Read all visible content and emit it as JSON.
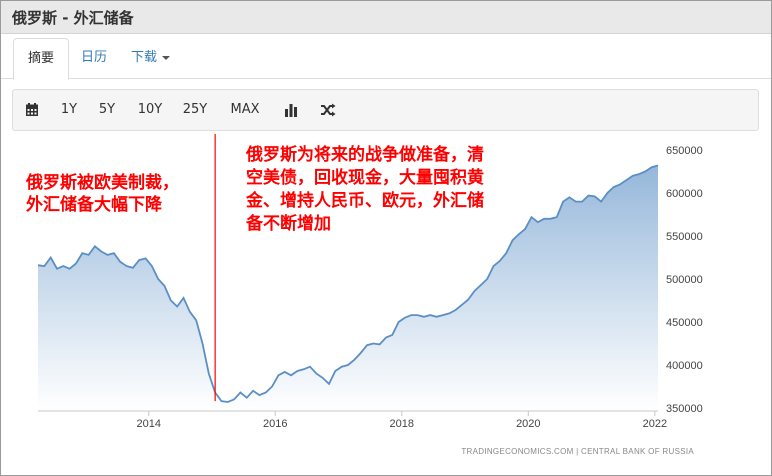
{
  "window": {
    "title": "俄罗斯 - 外汇储备"
  },
  "tabs": [
    {
      "label": "摘要",
      "active": true
    },
    {
      "label": "日历",
      "active": false
    },
    {
      "label": "下载",
      "active": false,
      "dropdown": true
    }
  ],
  "toolbar": {
    "icons": [
      "calendar-icon",
      "bar-chart-icon",
      "shuffle-icon"
    ],
    "ranges": [
      "1Y",
      "5Y",
      "10Y",
      "25Y",
      "MAX"
    ]
  },
  "annotations": {
    "left": [
      "俄罗斯被欧美制裁，",
      "外汇储备大幅下降"
    ],
    "right": [
      "俄罗斯为将来的战争做准备，清",
      "空美债，回收现金，大量囤积黄",
      "金、增持人民币、欧元，外汇储",
      "备不断增加"
    ],
    "marker_color": "#ff0000"
  },
  "source": "TRADINGECONOMICS.COM  |  CENTRAL BANK OF RUSSIA",
  "colors": {
    "line": "#5b8fc4",
    "fill_top": "#8fb3d8",
    "fill_bottom": "#ffffff"
  },
  "chart_data": {
    "type": "area",
    "xlim": [
      2012.25,
      2022.05
    ],
    "ylim": [
      350000,
      650000
    ],
    "x_ticks": [
      2014,
      2016,
      2018,
      2020,
      2022
    ],
    "x_tick_labels": [
      "2014",
      "2016",
      "2018",
      "2020",
      "2022"
    ],
    "y_ticks": [
      350000,
      400000,
      450000,
      500000,
      550000,
      600000,
      650000
    ],
    "y_tick_labels": [
      "350000",
      "400000",
      "450000",
      "500000",
      "550000",
      "600000",
      "650000"
    ],
    "grid": false,
    "marker_x": 2015.05,
    "x": [
      2012.25,
      2012.35,
      2012.45,
      2012.55,
      2012.65,
      2012.75,
      2012.85,
      2012.95,
      2013.05,
      2013.15,
      2013.25,
      2013.35,
      2013.45,
      2013.55,
      2013.65,
      2013.75,
      2013.85,
      2013.95,
      2014.05,
      2014.15,
      2014.25,
      2014.35,
      2014.45,
      2014.55,
      2014.65,
      2014.75,
      2014.85,
      2014.95,
      2015.05,
      2015.15,
      2015.25,
      2015.35,
      2015.45,
      2015.55,
      2015.65,
      2015.75,
      2015.85,
      2015.95,
      2016.05,
      2016.15,
      2016.25,
      2016.35,
      2016.45,
      2016.55,
      2016.65,
      2016.75,
      2016.85,
      2016.95,
      2017.05,
      2017.15,
      2017.25,
      2017.35,
      2017.45,
      2017.55,
      2017.65,
      2017.75,
      2017.85,
      2017.95,
      2018.05,
      2018.15,
      2018.25,
      2018.35,
      2018.45,
      2018.55,
      2018.65,
      2018.75,
      2018.85,
      2018.95,
      2019.05,
      2019.15,
      2019.25,
      2019.35,
      2019.45,
      2019.55,
      2019.65,
      2019.75,
      2019.85,
      2019.95,
      2020.05,
      2020.15,
      2020.25,
      2020.35,
      2020.45,
      2020.55,
      2020.65,
      2020.75,
      2020.85,
      2020.95,
      2021.05,
      2021.15,
      2021.25,
      2021.35,
      2021.45,
      2021.55,
      2021.65,
      2021.75,
      2021.85,
      2021.95,
      2022.05
    ],
    "values": [
      516000,
      515000,
      525000,
      512000,
      515000,
      512000,
      518000,
      530000,
      528000,
      538000,
      532000,
      528000,
      530000,
      520000,
      515000,
      513000,
      522000,
      524000,
      515000,
      500000,
      492000,
      475000,
      468000,
      478000,
      462000,
      452000,
      425000,
      390000,
      368000,
      358000,
      357000,
      360000,
      368000,
      362000,
      370000,
      365000,
      368000,
      375000,
      388000,
      392000,
      388000,
      393000,
      395000,
      398000,
      390000,
      385000,
      378000,
      393000,
      398000,
      400000,
      406000,
      414000,
      423000,
      425000,
      424000,
      432000,
      435000,
      450000,
      455000,
      458000,
      458000,
      456000,
      458000,
      456000,
      458000,
      460000,
      464000,
      470000,
      476000,
      486000,
      493000,
      500000,
      515000,
      521000,
      530000,
      545000,
      552000,
      558000,
      572000,
      566000,
      570000,
      570000,
      572000,
      590000,
      595000,
      590000,
      590000,
      597000,
      596000,
      590000,
      600000,
      607000,
      610000,
      615000,
      620000,
      622000,
      625000,
      630000,
      632000
    ]
  }
}
